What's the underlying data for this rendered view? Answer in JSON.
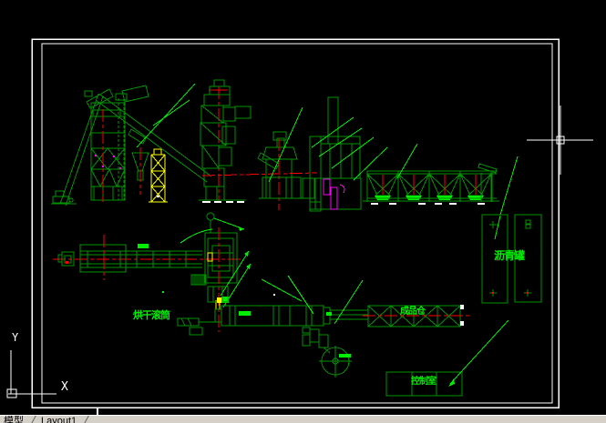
{
  "colors": {
    "background": "#000000",
    "line_green": "#009300",
    "bright_green": "#00ef00",
    "red": "#fd0000",
    "yellow": "#ffff00",
    "magenta": "#fb00fb",
    "white": "#ffffff",
    "tabbar_bg": "#d4d0c8",
    "tabbar_text": "#000000"
  },
  "drawing": {
    "labels": {
      "dryer_drum": "烘干滚筒",
      "finished_storage": "成品仓",
      "asphalt_tanks": "沥青罐",
      "control_room": "控制室"
    }
  },
  "ucs": {
    "x_axis_label": "X",
    "y_axis_label": "Y"
  },
  "tab_bar": {
    "model_tab": "模型",
    "layout_tab": "Layout1"
  }
}
